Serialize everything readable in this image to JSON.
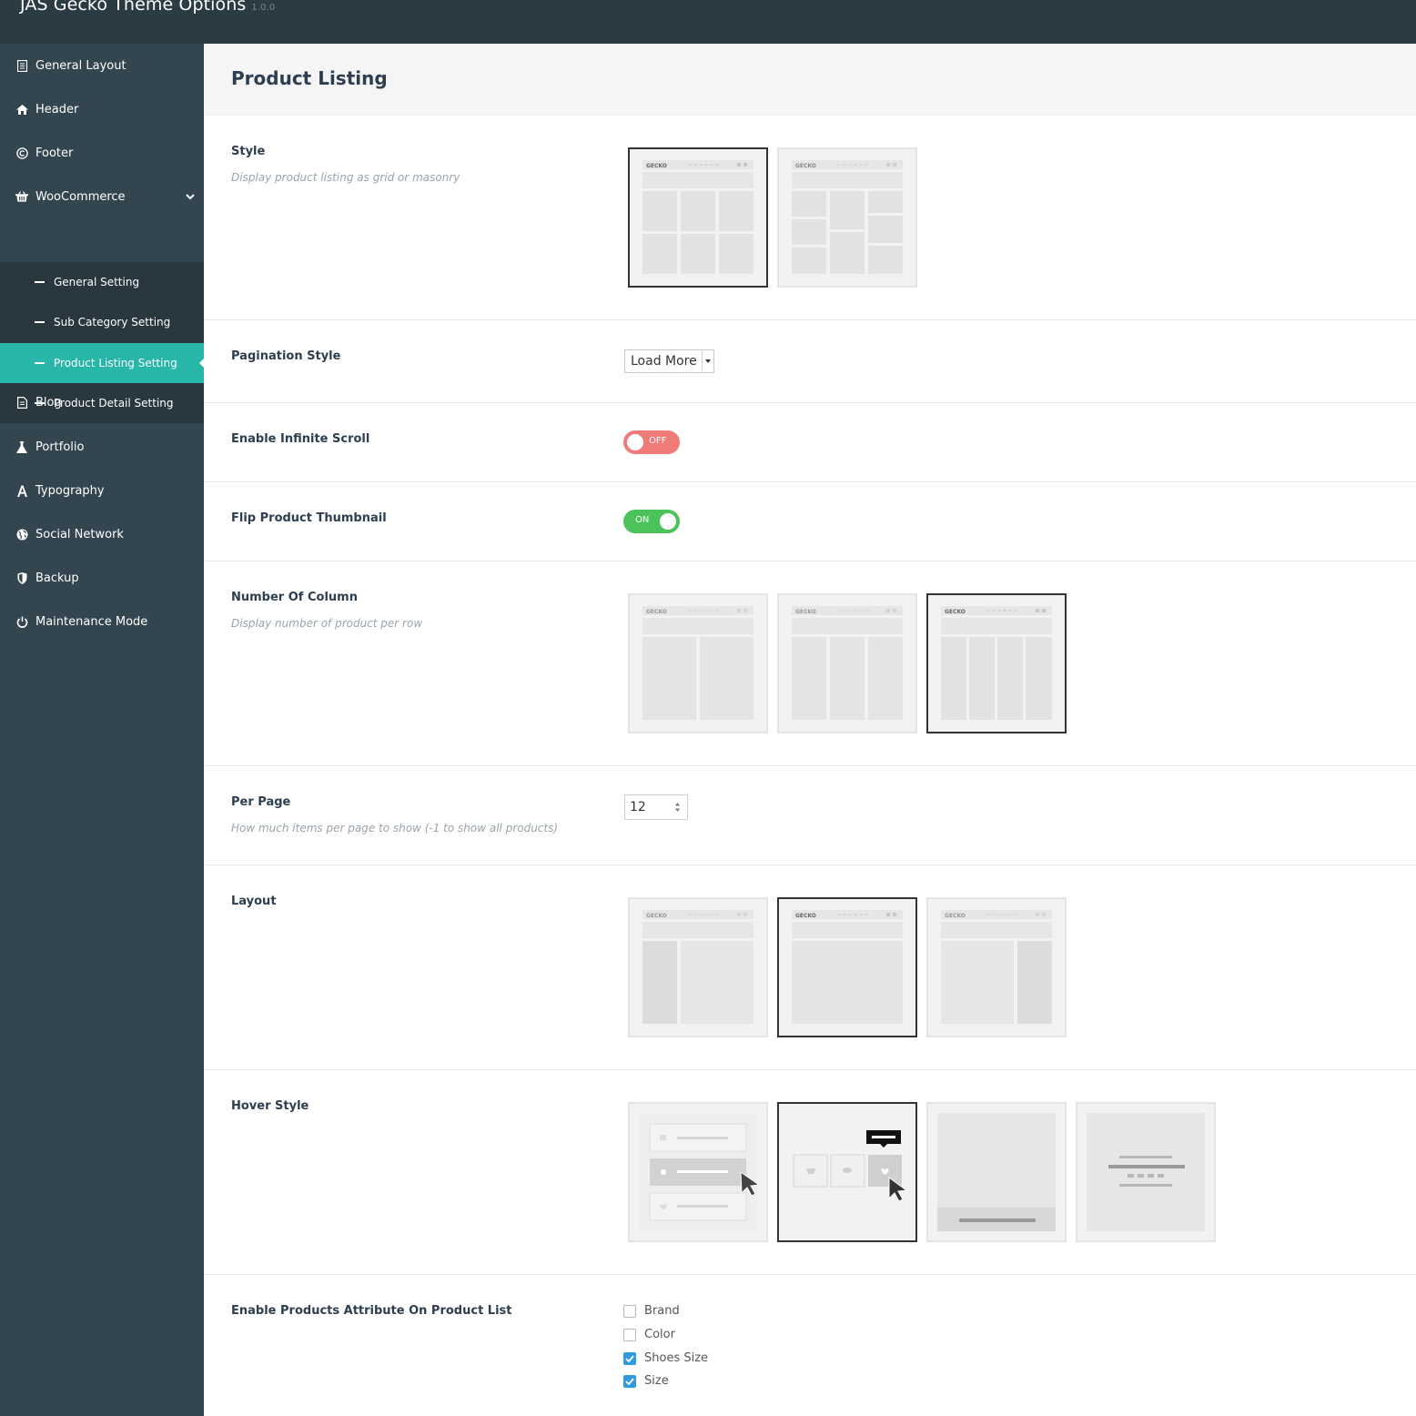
{
  "app": {
    "title": "JAS Gecko Theme Options",
    "version": "1.0.0"
  },
  "sidebar": {
    "items": [
      {
        "label": "General Layout",
        "icon": "document-icon"
      },
      {
        "label": "Header",
        "icon": "home-icon"
      },
      {
        "label": "Footer",
        "icon": "copyright-icon"
      },
      {
        "label": "WooCommerce",
        "icon": "basket-icon"
      },
      {
        "label": "Blog",
        "icon": "file-icon"
      },
      {
        "label": "Portfolio",
        "icon": "flask-icon"
      },
      {
        "label": "Typography",
        "icon": "font-icon"
      },
      {
        "label": "Social Network",
        "icon": "globe-icon"
      },
      {
        "label": "Backup",
        "icon": "shield-icon"
      },
      {
        "label": "Maintenance Mode",
        "icon": "power-icon"
      }
    ],
    "woocommerce_sub": [
      {
        "label": "General Setting"
      },
      {
        "label": "Sub Category Setting"
      },
      {
        "label": "Product Listing Setting"
      },
      {
        "label": "Product Detail Setting"
      }
    ],
    "active_sub": "Product Listing Setting"
  },
  "page": {
    "title": "Product Listing"
  },
  "settings": {
    "style": {
      "label": "Style",
      "desc": "Display product listing as grid or masonry",
      "options": [
        "grid",
        "masonry"
      ],
      "selected": "grid"
    },
    "pagination": {
      "label": "Pagination Style",
      "value": "Load More"
    },
    "infinite_scroll": {
      "label": "Enable Infinite Scroll",
      "state_text": "OFF"
    },
    "flip_thumbnail": {
      "label": "Flip Product Thumbnail",
      "state_text": "ON"
    },
    "columns": {
      "label": "Number Of Column",
      "desc": "Display number of product per row",
      "options": [
        2,
        3,
        4
      ],
      "selected": 4
    },
    "per_page": {
      "label": "Per Page",
      "desc": "How much items per page to show (-1 to show all products)",
      "value": "12"
    },
    "layout": {
      "label": "Layout",
      "options": [
        "left-sidebar",
        "no-sidebar",
        "right-sidebar"
      ],
      "selected": "no-sidebar"
    },
    "hover_style": {
      "label": "Hover Style",
      "options": [
        "list-buttons",
        "icon-buttons",
        "bottom-bar",
        "centered-text"
      ],
      "selected": "icon-buttons"
    },
    "attributes": {
      "label": "Enable Products Attribute On Product List",
      "items": [
        {
          "label": "Brand",
          "checked": false
        },
        {
          "label": "Color",
          "checked": false
        },
        {
          "label": "Shoes Size",
          "checked": true
        },
        {
          "label": "Size",
          "checked": true
        }
      ]
    }
  },
  "thumbnail_brand": "GECKO",
  "colors": {
    "accent": "#28b6a8",
    "sidebar": "#33454f",
    "topbar": "#2b3b44",
    "toggle_off": "#f07a78",
    "toggle_on": "#4cc35a",
    "checkbox": "#2f9bde"
  }
}
